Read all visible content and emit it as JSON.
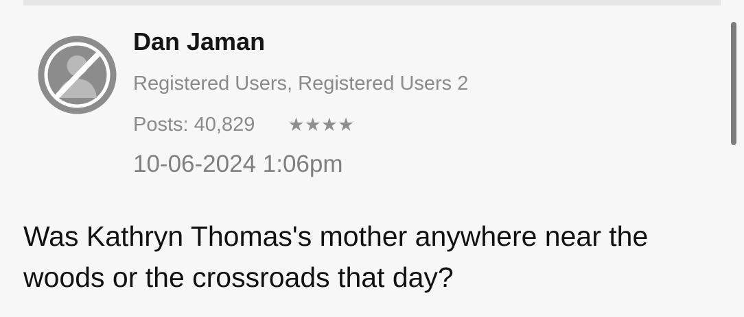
{
  "post": {
    "author": {
      "name": "Dan Jaman",
      "role": "Registered Users, Registered Users 2",
      "posts_text": "Posts: 40,829",
      "rank_stars": 4,
      "avatar_icon": "no-avatar-icon"
    },
    "timestamp": "10-06-2024 1:06pm",
    "body": "Was Kathryn Thomas's mother anywhere near the woods or the crossroads that day?"
  },
  "colors": {
    "background": "#f7f7f7",
    "secondary_text": "#8a8a8a",
    "avatar_gray": "#8c8c8c"
  }
}
